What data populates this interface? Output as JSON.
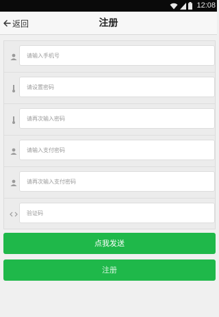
{
  "statusbar": {
    "time": "12:08",
    "icons": [
      "wifi-icon",
      "signal-icon",
      "battery-icon"
    ]
  },
  "header": {
    "back_label": "返回",
    "title": "注册"
  },
  "form": {
    "fields": [
      {
        "icon": "user-icon",
        "placeholder": "请输入手机号",
        "value": ""
      },
      {
        "icon": "key-icon",
        "placeholder": "请设置密码",
        "value": ""
      },
      {
        "icon": "key-icon",
        "placeholder": "请再次输入密码",
        "value": ""
      },
      {
        "icon": "user-icon",
        "placeholder": "请输入支付密码",
        "value": ""
      },
      {
        "icon": "user-icon",
        "placeholder": "请再次输入支付密码",
        "value": ""
      },
      {
        "icon": "code-icon",
        "placeholder": "验证码",
        "value": ""
      }
    ]
  },
  "buttons": {
    "send_label": "点我发送",
    "register_label": "注册"
  },
  "colors": {
    "accent": "#1fb84a",
    "statusbar": "#0a0a0a",
    "background": "#f0f0f0"
  }
}
